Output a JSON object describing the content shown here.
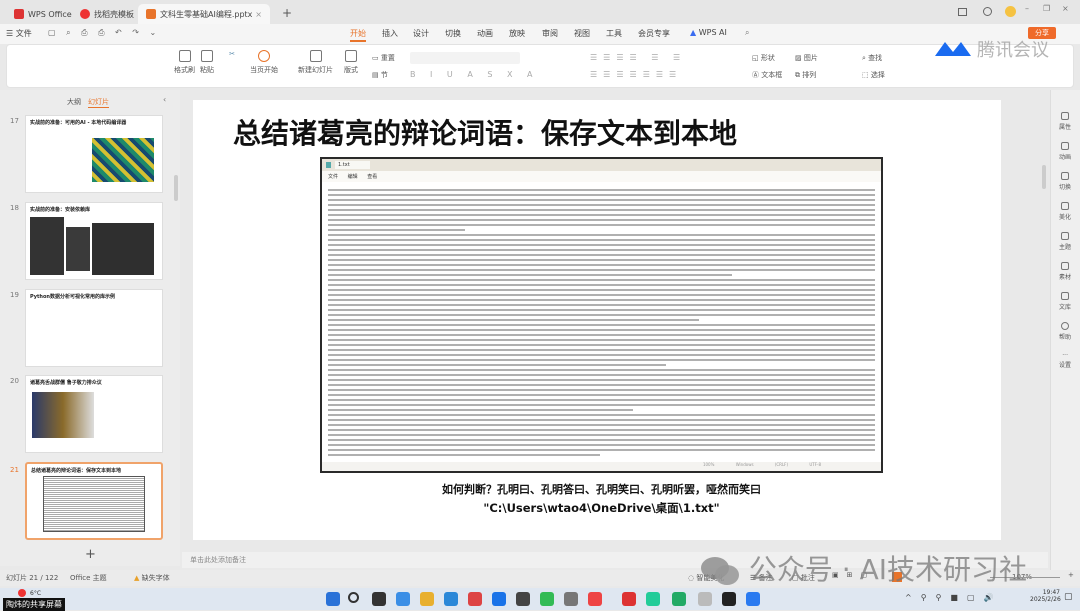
{
  "tabs": [
    {
      "label": "WPS Office"
    },
    {
      "label": "找稻壳模板"
    },
    {
      "label": "文科生零基础AI编程.pptx"
    }
  ],
  "menubar": {
    "file": "文件",
    "items": [
      "开始",
      "插入",
      "设计",
      "切换",
      "动画",
      "放映",
      "审阅",
      "视图",
      "工具",
      "会员专享",
      "WPS AI"
    ],
    "share": "分享"
  },
  "ribbon": {
    "format_painter": "格式刷",
    "paste": "粘贴",
    "play_current": "当页开始",
    "new_slide": "新建幻灯片",
    "layout": "版式",
    "section": "节",
    "reset": "重置",
    "shape": "形状",
    "picture": "图片",
    "textbox": "文本框",
    "arrange": "排列",
    "find": "查找",
    "select": "选择"
  },
  "left_panel": {
    "tab_outline": "大纲",
    "tab_slides": "幻灯片",
    "thumbs": [
      {
        "num": "17",
        "title": "实战前的准备：可用的AI - 本地代码编译器"
      },
      {
        "num": "18",
        "title": "实战前的准备：安装依赖库"
      },
      {
        "num": "19",
        "title": "Python数据分析可视化常用的库示例"
      },
      {
        "num": "20",
        "title": "诸葛亮舌战群儒 鲁子敬力排众议"
      },
      {
        "num": "21",
        "title": "总结诸葛亮的辩论词语：保存文本到本地"
      }
    ],
    "add": "+"
  },
  "slide": {
    "title": "总结诸葛亮的辩论词语：保存文本到本地",
    "notepad": {
      "tab": "1.txt",
      "menu": [
        "文件",
        "编辑",
        "查看"
      ],
      "status": [
        "100%",
        "Windows (CRLF)",
        "UTF-8"
      ]
    },
    "caption1": "如何判断？孔明曰、孔明答曰、孔明笑曰、孔明听罢，哑然而笑曰",
    "caption2": "\"C:\\Users\\wtao4\\OneDrive\\桌面\\1.txt\""
  },
  "notes_placeholder": "单击此处添加备注",
  "status": {
    "slide_count": "幻灯片 21 / 122",
    "theme": "Office 主题",
    "missing_font": "缺失字体",
    "beautify": "智能美化",
    "notes": "备注",
    "comments": "批注",
    "zoom": "107%"
  },
  "right_sidebar": [
    "属性",
    "动画",
    "切换",
    "美化",
    "主题",
    "素材",
    "文库",
    "帮助",
    "设置"
  ],
  "taskbar": {
    "weather": "6°C",
    "time": "19:47",
    "date": "2025/2/26",
    "share_label": "陶炜的共享屏幕"
  },
  "overlay": {
    "meeting_logo": "腾讯会议",
    "watermark": "公众号 · AI技术研习社"
  },
  "colors": {
    "accent": "#e8742b",
    "share_btn": "#ef6a2a",
    "meeting": "#1a6bf0"
  }
}
